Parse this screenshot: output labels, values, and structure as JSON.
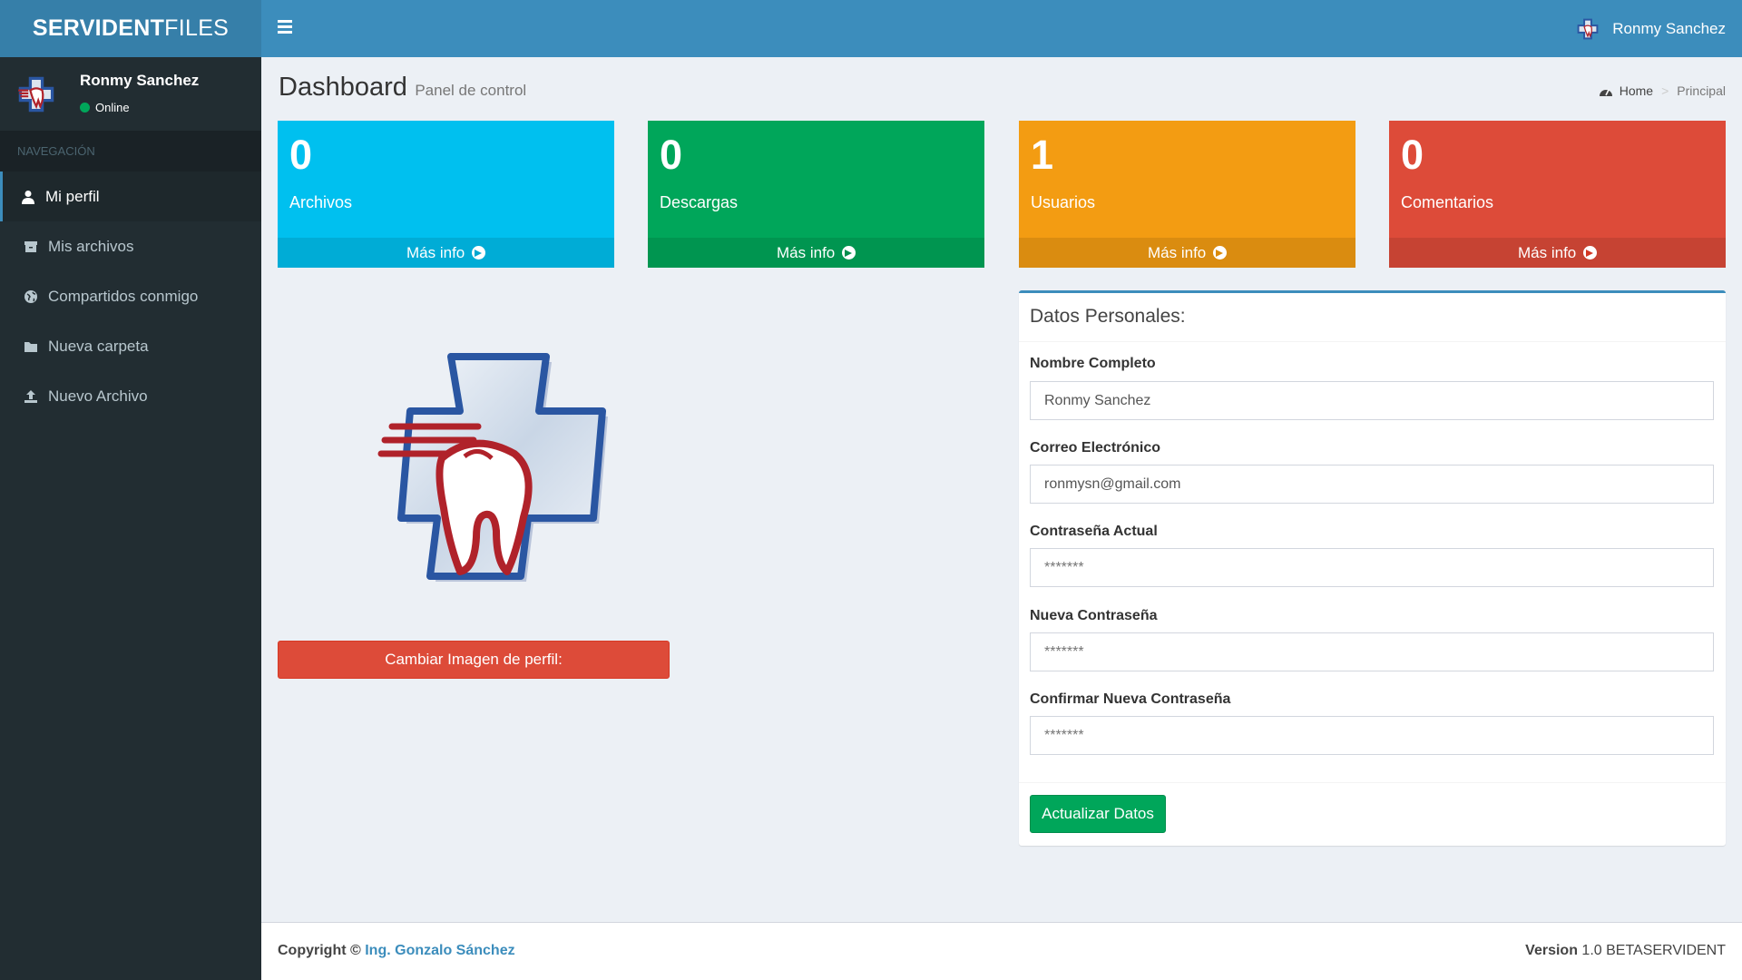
{
  "brand": {
    "bold": "SERVIDENT",
    "light": "FILES"
  },
  "header": {
    "user_name": "Ronmy Sanchez"
  },
  "sidebar": {
    "user_name": "Ronmy Sanchez",
    "status": "Online",
    "nav_header": "NAVEGACIÓN",
    "items": [
      {
        "label": "Mi perfil",
        "icon": "user-icon",
        "active": true
      },
      {
        "label": "Mis archivos",
        "icon": "archive-icon",
        "active": false
      },
      {
        "label": "Compartidos conmigo",
        "icon": "globe-icon",
        "active": false
      },
      {
        "label": "Nueva carpeta",
        "icon": "folder-icon",
        "active": false
      },
      {
        "label": "Nuevo Archivo",
        "icon": "upload-icon",
        "active": false
      }
    ]
  },
  "content_header": {
    "title": "Dashboard",
    "subtitle": "Panel de control"
  },
  "breadcrumb": {
    "home": "Home",
    "current": "Principal"
  },
  "boxes": [
    {
      "value": "0",
      "label": "Archivos",
      "more": "Más info",
      "color": "#00c0ef"
    },
    {
      "value": "0",
      "label": "Descargas",
      "more": "Más info",
      "color": "#00a65a"
    },
    {
      "value": "1",
      "label": "Usuarios",
      "more": "Más info",
      "color": "#f39c12"
    },
    {
      "value": "0",
      "label": "Comentarios",
      "more": "Más info",
      "color": "#dd4b39"
    }
  ],
  "profile": {
    "change_image_label": "Cambiar Imagen de perfil:"
  },
  "form": {
    "title": "Datos Personales:",
    "fields": [
      {
        "label": "Nombre Completo",
        "value": "Ronmy Sanchez",
        "placeholder": ""
      },
      {
        "label": "Correo Electrónico",
        "value": "ronmysn@gmail.com",
        "placeholder": ""
      },
      {
        "label": "Contraseña Actual",
        "value": "",
        "placeholder": "*******"
      },
      {
        "label": "Nueva Contraseña",
        "value": "",
        "placeholder": "*******"
      },
      {
        "label": "Confirmar Nueva Contraseña",
        "value": "",
        "placeholder": "*******"
      }
    ],
    "submit_label": "Actualizar Datos"
  },
  "footer": {
    "copyright": "Copyright ©",
    "author": "Ing. Gonzalo Sánchez",
    "version_label": "Version",
    "version_value": "1.0 BETASERVIDENT"
  },
  "colors": {
    "header": "#3c8dbc",
    "logo_bg": "#367fa9",
    "sidebar": "#222d32",
    "content_bg": "#ecf0f5"
  }
}
